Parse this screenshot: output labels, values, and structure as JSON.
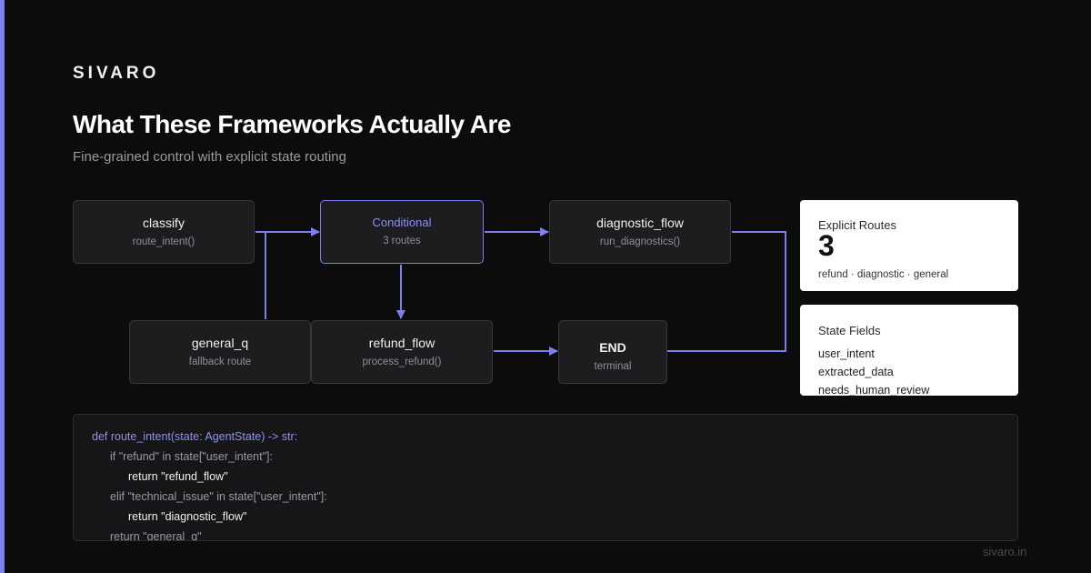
{
  "brand": "SIVARO",
  "title": "What These Frameworks Actually Are",
  "subtitle": "Fine-grained control with explicit state routing",
  "colors": {
    "accent": "#7b7ff0",
    "node_bg": "#1d1d20",
    "node_border": "#36363b",
    "background": "#0c0c0d"
  },
  "nodes": {
    "classify": {
      "title": "classify",
      "sub": "route_intent()"
    },
    "conditional": {
      "title": "Conditional",
      "sub": "3 routes"
    },
    "diagnostic": {
      "title": "diagnostic_flow",
      "sub": "run_diagnostics()"
    },
    "general": {
      "title": "general_q",
      "sub": "fallback route"
    },
    "refund": {
      "title": "refund_flow",
      "sub": "process_refund()"
    },
    "end": {
      "title": "END",
      "sub": "terminal"
    }
  },
  "cards": {
    "routes": {
      "label": "Explicit Routes",
      "value": "3",
      "note": "refund · diagnostic · general"
    },
    "state": {
      "label": "State Fields",
      "fields": [
        "user_intent",
        "extracted_data",
        "needs_human_review"
      ]
    }
  },
  "code": [
    "def route_intent(state: AgentState) -> str:",
    "if \"refund\" in state[\"user_intent\"]:",
    "return \"refund_flow\"",
    "elif \"technical_issue\" in state[\"user_intent\"]:",
    "return \"diagnostic_flow\"",
    "return \"general_q\""
  ],
  "footer": "sivaro.in"
}
